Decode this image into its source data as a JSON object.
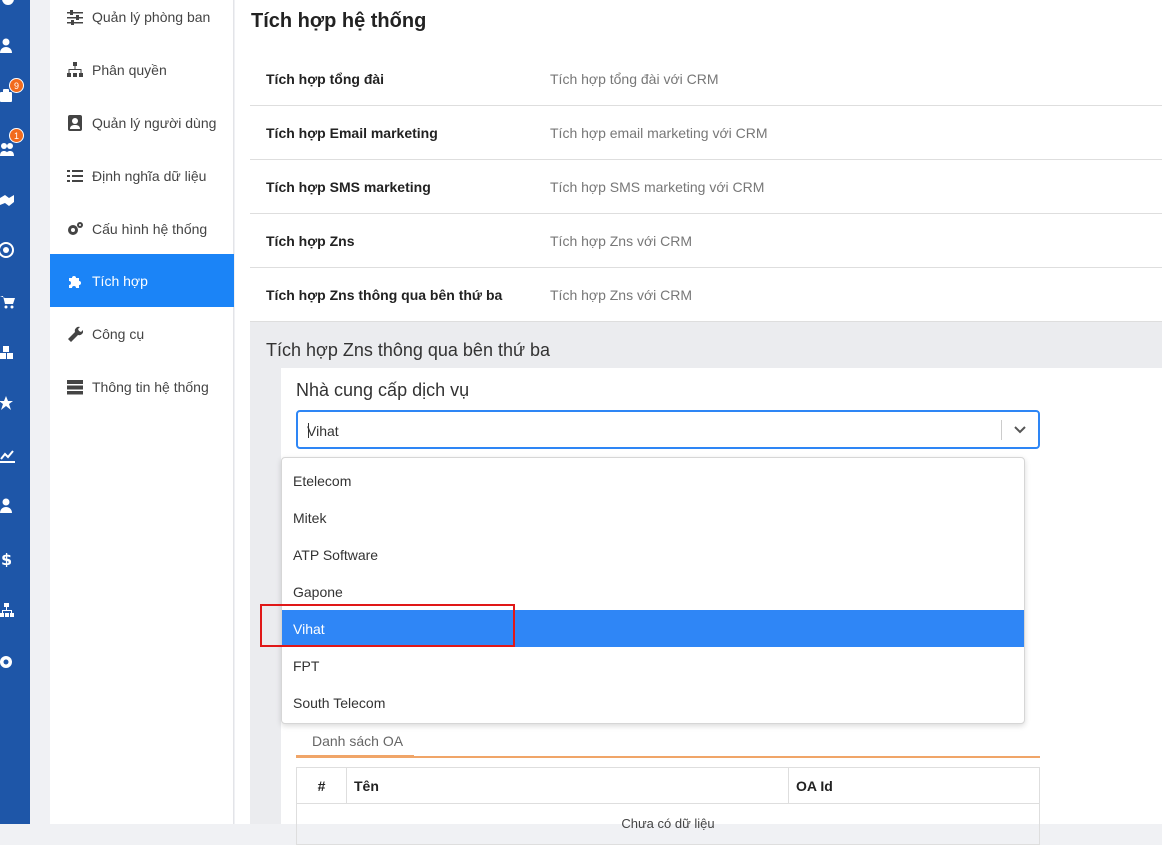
{
  "rail": {
    "badge_inventory": "9",
    "badge_users": "1"
  },
  "menu": {
    "items": [
      {
        "label": "Quản lý phòng ban",
        "icon": "sliders-icon"
      },
      {
        "label": "Phân quyền",
        "icon": "sitemap-icon"
      },
      {
        "label": "Quản lý người dùng",
        "icon": "user-card-icon"
      },
      {
        "label": "Định nghĩa dữ liệu",
        "icon": "list-icon"
      },
      {
        "label": "Cấu hình hệ thống",
        "icon": "gears-icon"
      },
      {
        "label": "Tích hợp",
        "icon": "puzzle-icon",
        "active": true
      },
      {
        "label": "Công cụ",
        "icon": "wrench-icon"
      },
      {
        "label": "Thông tin hệ thống",
        "icon": "server-icon"
      }
    ]
  },
  "page": {
    "title": "Tích hợp hệ thống",
    "integrations": [
      {
        "name": "Tích hợp tổng đài",
        "desc": "Tích hợp tổng đài với CRM"
      },
      {
        "name": "Tích hợp Email marketing",
        "desc": "Tích hợp email marketing với CRM"
      },
      {
        "name": "Tích hợp SMS marketing",
        "desc": "Tích hợp SMS marketing với CRM"
      },
      {
        "name": "Tích hợp Zns",
        "desc": "Tích hợp Zns với CRM"
      },
      {
        "name": "Tích hợp Zns thông qua bên thứ ba",
        "desc": "Tích hợp Zns với CRM"
      }
    ]
  },
  "panel": {
    "title": "Tích hợp Zns thông qua bên thứ ba",
    "provider_label": "Nhà cung cấp dịch vụ",
    "provider_value": "Vihat",
    "tab_label": "Danh sách OA",
    "table_headers": [
      "#",
      "Tên",
      "OA Id"
    ],
    "empty_text": "Chưa có dữ liệu"
  },
  "dropdown": {
    "options": [
      "Etelecom",
      "Mitek",
      "ATP Software",
      "Gapone",
      "Vihat",
      "FPT",
      "South Telecom"
    ],
    "selected": "Vihat"
  },
  "colors": {
    "rail": "#1e56a8",
    "active": "#1b84f7",
    "highlight": "#e01818",
    "badge": "#f26b1d"
  }
}
